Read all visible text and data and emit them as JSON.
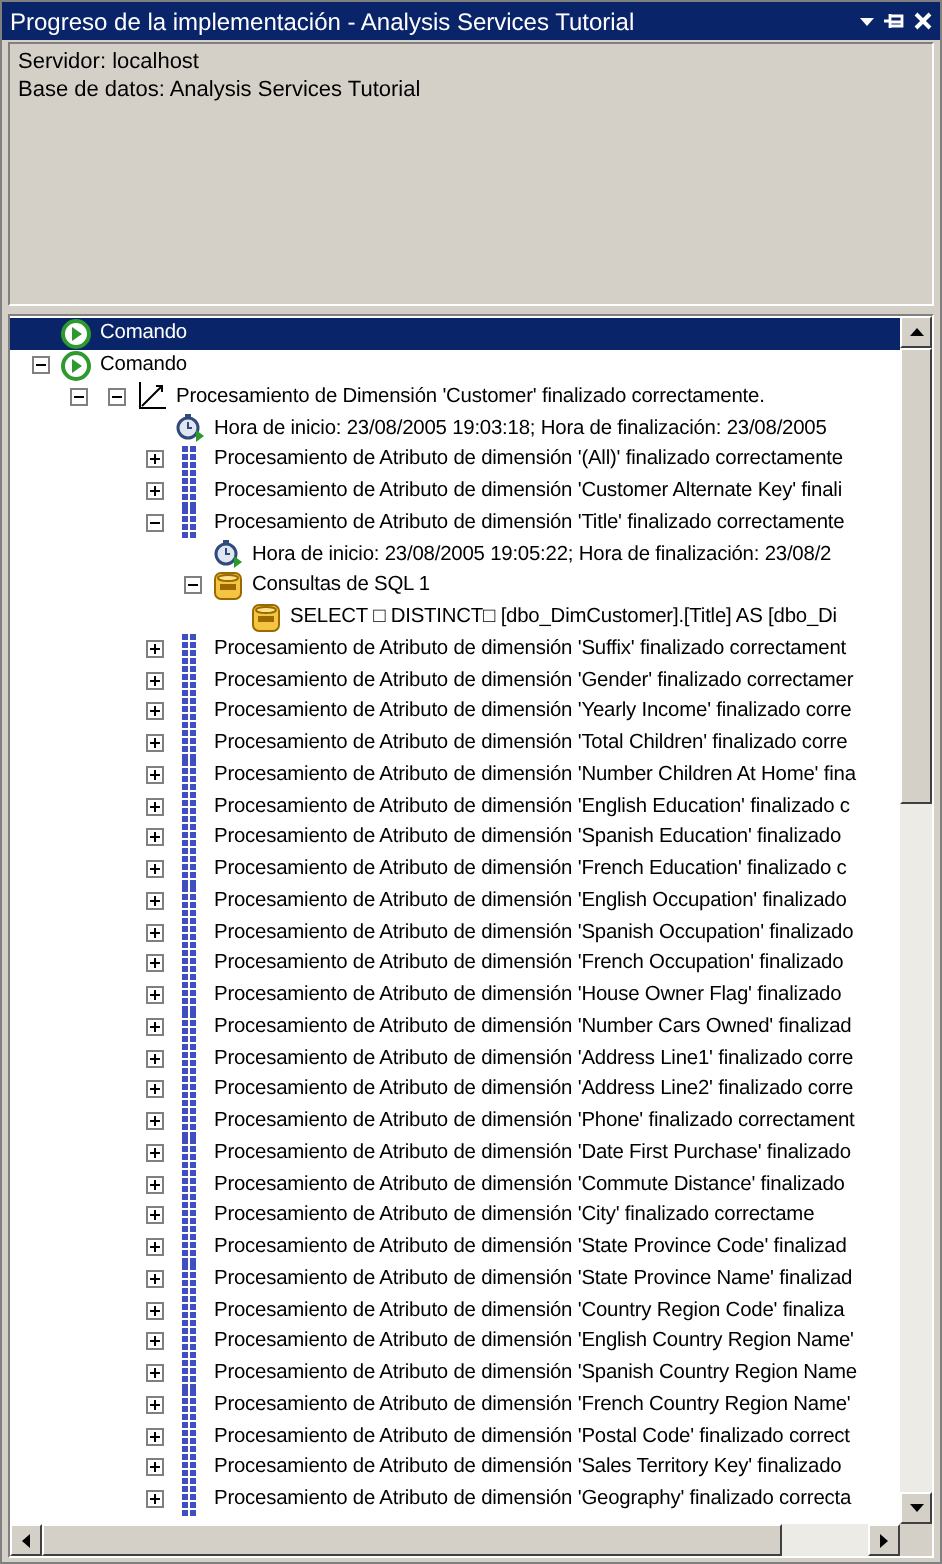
{
  "window": {
    "title": "Progreso de la implementación - Analysis Services Tutorial"
  },
  "info": {
    "lines": [
      "Servidor: localhost",
      "Base de datos: Analysis Services Tutorial"
    ]
  },
  "tree": [
    {
      "kind": "command",
      "text": "Comando",
      "selected": true
    },
    {
      "kind": "command",
      "text": "Comando",
      "selected": false,
      "expanded": true,
      "children": [
        {
          "kind": "dimension",
          "text": "Procesamiento de Dimensión 'Customer' finalizado correctamente.",
          "selected": false,
          "expanded": true,
          "children": [
            {
              "kind": "timer",
              "text": "Hora de inicio: 23/08/2005 19:03:18; Hora de finalización: 23/08/2005",
              "selected": false
            },
            {
              "kind": "attribute",
              "text": "Procesamiento de Atributo de dimensión '(All)' finalizado correctamente",
              "selected": false,
              "expanded": false
            },
            {
              "kind": "attribute",
              "text": "Procesamiento de Atributo de dimensión 'Customer Alternate Key' finali",
              "selected": false,
              "expanded": false
            },
            {
              "kind": "attribute",
              "text": "Procesamiento de Atributo de dimensión 'Title' finalizado correctamente",
              "selected": false,
              "expanded": true,
              "children": [
                {
                  "kind": "timer",
                  "text": "Hora de inicio: 23/08/2005 19:05:22; Hora de finalización: 23/08/2",
                  "selected": false
                },
                {
                  "kind": "sql",
                  "text": "Consultas de SQL 1",
                  "selected": false,
                  "expanded": true,
                  "children": [
                    {
                      "kind": "sql",
                      "text": "SELECT □  DISTINCT□ [dbo_DimCustomer].[Title] AS [dbo_Di",
                      "selected": false
                    }
                  ]
                }
              ]
            },
            {
              "kind": "attribute",
              "text": "Procesamiento de Atributo de dimensión 'Suffix' finalizado correctament",
              "selected": false,
              "expanded": false
            },
            {
              "kind": "attribute",
              "text": "Procesamiento de Atributo de dimensión 'Gender' finalizado correctamer",
              "selected": false,
              "expanded": false
            },
            {
              "kind": "attribute",
              "text": "Procesamiento de Atributo de dimensión 'Yearly Income' finalizado corre",
              "selected": false,
              "expanded": false
            },
            {
              "kind": "attribute",
              "text": "Procesamiento de Atributo de dimensión 'Total Children' finalizado corre",
              "selected": false,
              "expanded": false
            },
            {
              "kind": "attribute",
              "text": "Procesamiento de Atributo de dimensión 'Number Children At Home' fina",
              "selected": false,
              "expanded": false
            },
            {
              "kind": "attribute",
              "text": "Procesamiento de Atributo de dimensión 'English Education' finalizado c",
              "selected": false,
              "expanded": false
            },
            {
              "kind": "attribute",
              "text": "Procesamiento de Atributo de dimensión 'Spanish Education' finalizado",
              "selected": false,
              "expanded": false
            },
            {
              "kind": "attribute",
              "text": "Procesamiento de Atributo de dimensión 'French Education' finalizado c",
              "selected": false,
              "expanded": false
            },
            {
              "kind": "attribute",
              "text": "Procesamiento de Atributo de dimensión 'English Occupation' finalizado",
              "selected": false,
              "expanded": false
            },
            {
              "kind": "attribute",
              "text": "Procesamiento de Atributo de dimensión 'Spanish Occupation' finalizado",
              "selected": false,
              "expanded": false
            },
            {
              "kind": "attribute",
              "text": "Procesamiento de Atributo de dimensión 'French Occupation' finalizado",
              "selected": false,
              "expanded": false
            },
            {
              "kind": "attribute",
              "text": "Procesamiento de Atributo de dimensión 'House Owner Flag' finalizado",
              "selected": false,
              "expanded": false
            },
            {
              "kind": "attribute",
              "text": "Procesamiento de Atributo de dimensión 'Number Cars Owned' finalizad",
              "selected": false,
              "expanded": false
            },
            {
              "kind": "attribute",
              "text": "Procesamiento de Atributo de dimensión 'Address Line1' finalizado corre",
              "selected": false,
              "expanded": false
            },
            {
              "kind": "attribute",
              "text": "Procesamiento de Atributo de dimensión 'Address Line2' finalizado corre",
              "selected": false,
              "expanded": false
            },
            {
              "kind": "attribute",
              "text": "Procesamiento de Atributo de dimensión 'Phone' finalizado correctament",
              "selected": false,
              "expanded": false
            },
            {
              "kind": "attribute",
              "text": "Procesamiento de Atributo de dimensión 'Date First Purchase' finalizado",
              "selected": false,
              "expanded": false
            },
            {
              "kind": "attribute",
              "text": "Procesamiento de Atributo de dimensión 'Commute Distance' finalizado",
              "selected": false,
              "expanded": false
            },
            {
              "kind": "attribute",
              "text": "Procesamiento de Atributo de dimensión 'City' finalizado correctame",
              "selected": false,
              "expanded": false
            },
            {
              "kind": "attribute",
              "text": "Procesamiento de Atributo de dimensión 'State Province Code' finalizad",
              "selected": false,
              "expanded": false
            },
            {
              "kind": "attribute",
              "text": "Procesamiento de Atributo de dimensión 'State Province Name' finalizad",
              "selected": false,
              "expanded": false
            },
            {
              "kind": "attribute",
              "text": "Procesamiento de Atributo de dimensión 'Country Region Code' finaliza",
              "selected": false,
              "expanded": false
            },
            {
              "kind": "attribute",
              "text": "Procesamiento de Atributo de dimensión 'English Country Region Name'",
              "selected": false,
              "expanded": false
            },
            {
              "kind": "attribute",
              "text": "Procesamiento de Atributo de dimensión 'Spanish Country Region Name",
              "selected": false,
              "expanded": false
            },
            {
              "kind": "attribute",
              "text": "Procesamiento de Atributo de dimensión 'French Country Region Name'",
              "selected": false,
              "expanded": false
            },
            {
              "kind": "attribute",
              "text": "Procesamiento de Atributo de dimensión 'Postal Code' finalizado correct",
              "selected": false,
              "expanded": false
            },
            {
              "kind": "attribute",
              "text": "Procesamiento de Atributo de dimensión 'Sales Territory Key' finalizado",
              "selected": false,
              "expanded": false
            },
            {
              "kind": "attribute",
              "text": "Procesamiento de Atributo de dimensión 'Geography' finalizado correcta",
              "selected": false,
              "expanded": false
            }
          ]
        }
      ]
    }
  ]
}
